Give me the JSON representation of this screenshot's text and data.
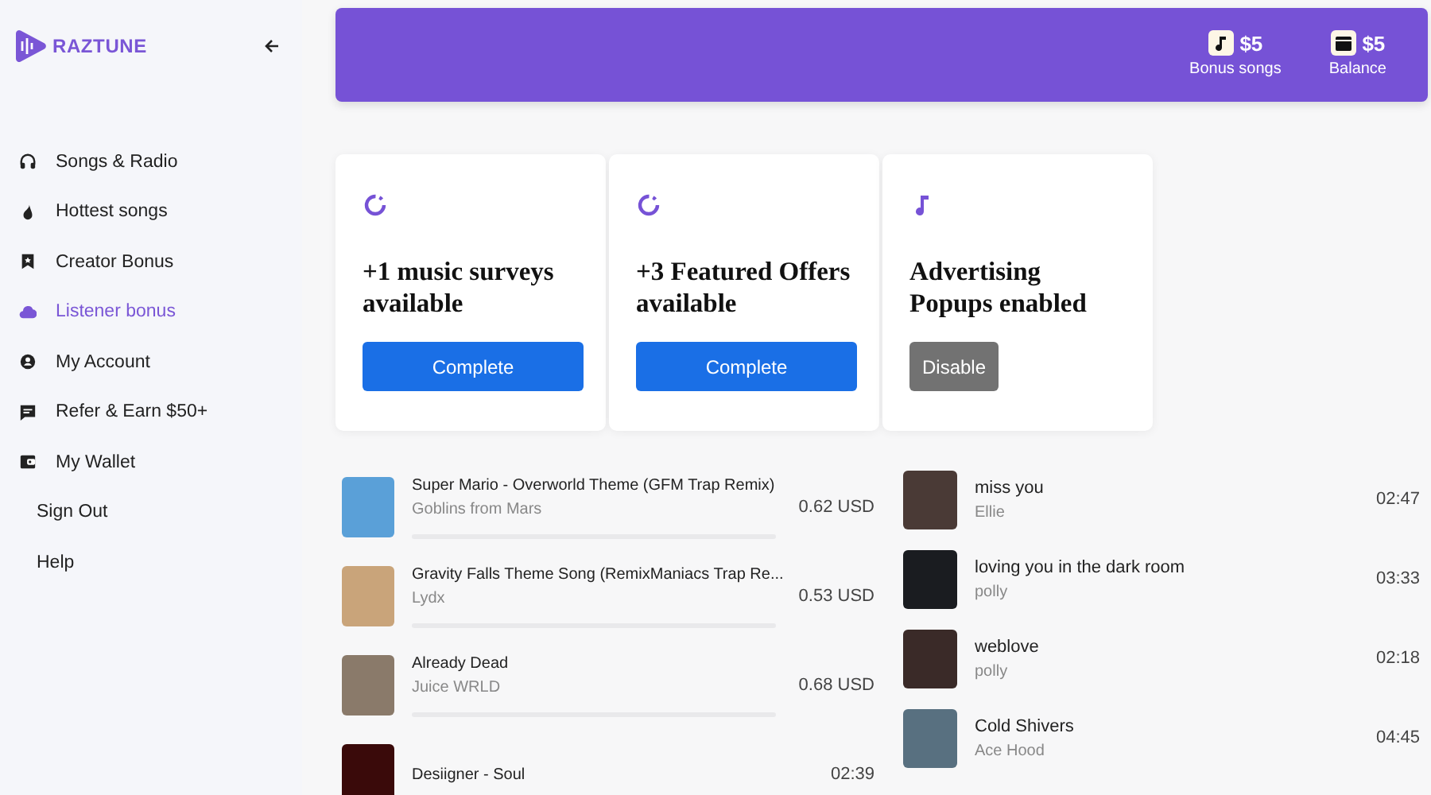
{
  "sidebar": {
    "logo": "RAZTUNE",
    "items": [
      {
        "label": "Songs & Radio",
        "selected": false
      },
      {
        "label": "Hottest songs",
        "selected": false
      },
      {
        "label": "Creator Bonus",
        "selected": false
      },
      {
        "label": "Listener bonus",
        "selected": true
      },
      {
        "label": "My Account",
        "selected": false
      },
      {
        "label": "Refer & Earn $50+",
        "selected": false
      },
      {
        "label": "My Wallet",
        "selected": false
      }
    ],
    "links": [
      "Sign Out",
      "Help"
    ]
  },
  "header": {
    "stats": [
      {
        "value": "$5",
        "label": "Bonus songs"
      },
      {
        "value": "$5",
        "label": "Balance"
      }
    ]
  },
  "offers": [
    {
      "title": "+1 music surveys available",
      "button": "Complete",
      "kind": "primary"
    },
    {
      "title": "+3 Featured Offers available",
      "button": "Complete",
      "kind": "primary"
    },
    {
      "title": "Advertising Popups enabled",
      "button": "Disable",
      "kind": "secondary"
    }
  ],
  "earn_tracks": [
    {
      "title": "Super Mario - Overworld Theme (GFM Trap Remix)",
      "artist": "Goblins from Mars",
      "price": "0.62 USD"
    },
    {
      "title": "Gravity Falls Theme Song (RemixManiacs Trap Re...",
      "artist": "Lydx",
      "price": "0.53 USD"
    },
    {
      "title": "Already Dead",
      "artist": "Juice WRLD",
      "price": "0.68 USD"
    },
    {
      "title": "Desiigner - Soul",
      "price": "02:39"
    }
  ],
  "recent_tracks": [
    {
      "title": "miss you",
      "artist": "Ellie",
      "duration": "02:47"
    },
    {
      "title": "loving you in the dark room",
      "artist": "polly",
      "duration": "03:33"
    },
    {
      "title": "weblove",
      "artist": "polly",
      "duration": "02:18"
    },
    {
      "title": "Cold Shivers",
      "artist": "Ace Hood",
      "duration": "04:45"
    }
  ]
}
